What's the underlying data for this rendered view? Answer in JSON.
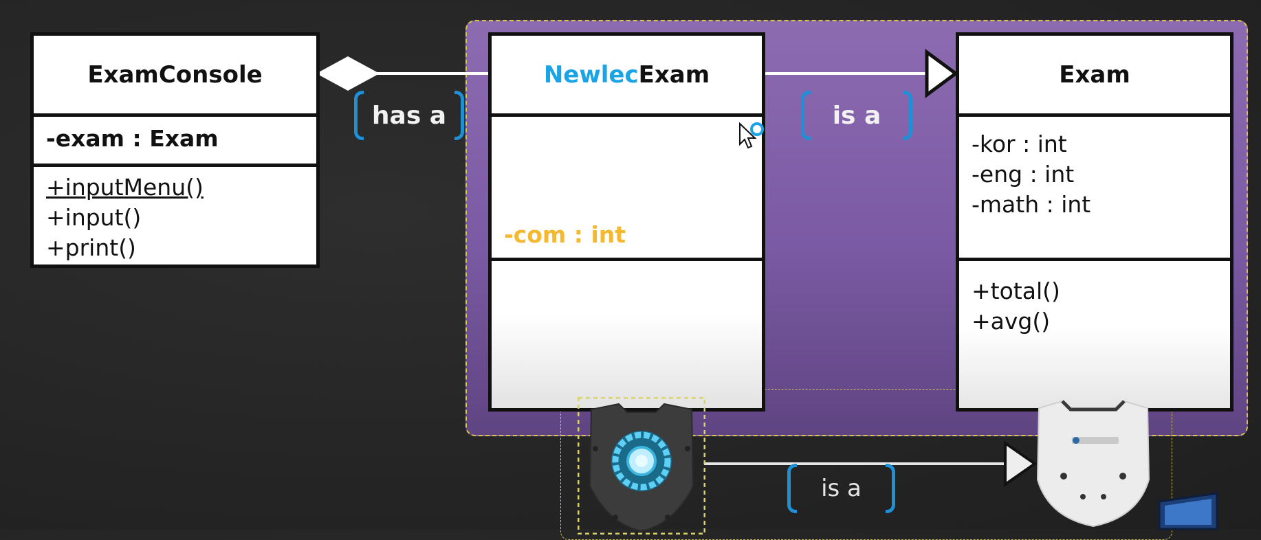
{
  "exam_console": {
    "name": "ExamConsole",
    "attribute": "-exam : Exam",
    "operations": [
      "+inputMenu()",
      "+input()",
      "+print()"
    ]
  },
  "newlec_exam": {
    "name_prefix": "Newlec",
    "name_suffix": "Exam",
    "attribute": "-com : int"
  },
  "exam": {
    "name": "Exam",
    "attributes": [
      "-kor : int",
      "-eng : int",
      "-math : int"
    ],
    "operations": [
      "+total()",
      "+avg()"
    ]
  },
  "relations": {
    "has_a": "has a",
    "is_a_top": "is a",
    "is_a_bottom": "is a"
  },
  "colors": {
    "newlec_prefix": "#1aa3e6",
    "com_attribute": "#f5b82e",
    "bracket": "#1e90d6",
    "purple_region": "#8c6bb1"
  },
  "icons": [
    "cursor-icon",
    "shield-arc-reactor-icon",
    "shield-ubtech-icon",
    "device-icon"
  ]
}
